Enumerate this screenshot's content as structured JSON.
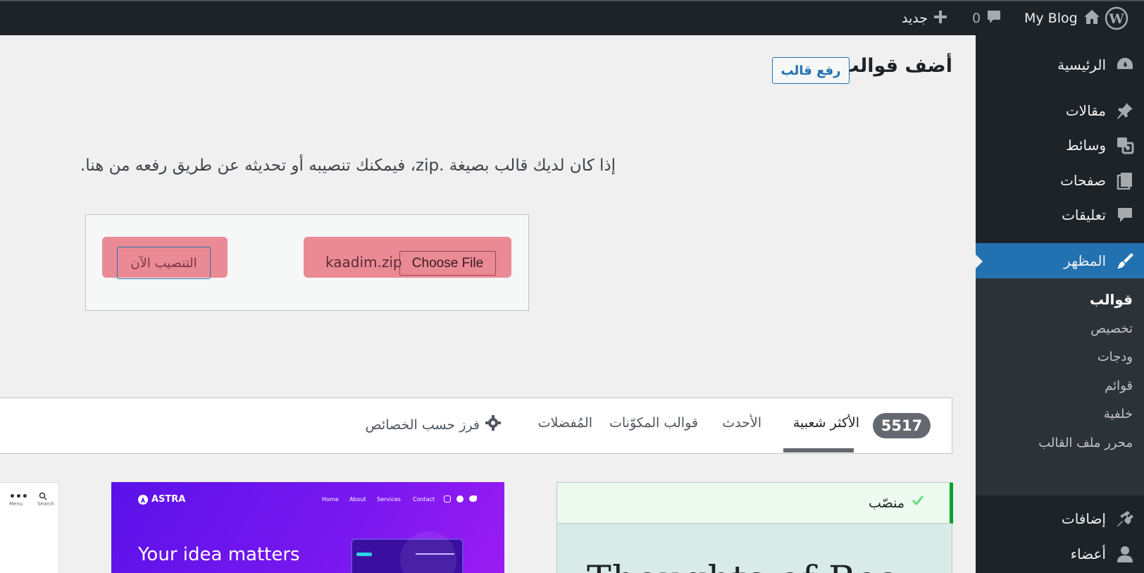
{
  "adminbar": {
    "site_name": "My Blog",
    "comments_count": "0",
    "new_label": "جديد"
  },
  "sidebar": {
    "items": [
      {
        "label": "الرئيسية",
        "icon": "dashboard-icon"
      },
      {
        "label": "مقالات",
        "icon": "pin-icon"
      },
      {
        "label": "وسائط",
        "icon": "media-icon"
      },
      {
        "label": "صفحات",
        "icon": "pages-icon"
      },
      {
        "label": "تعليقات",
        "icon": "comment-icon"
      },
      {
        "label": "المظهر",
        "icon": "appearance-icon"
      },
      {
        "label": "إضافات",
        "icon": "plugin-icon"
      },
      {
        "label": "أعضاء",
        "icon": "user-icon"
      }
    ],
    "submenu": [
      "قوالب",
      "تخصيص",
      "ودجات",
      "قوائم",
      "خلفية",
      "محرر ملف القالب"
    ]
  },
  "main": {
    "page_title": "أضف قوالب",
    "upload_button": "رفع قالب",
    "intro_text": "إذا كان لديك قالب بصيغة .zip، فيمكنك تنصيبه أو تحديثه عن طريق رفعه من هنا.",
    "install_now": "التنصيب الآن",
    "file_name": "kaadim.zip",
    "choose_file": "Choose File"
  },
  "filter": {
    "count": "5517",
    "tabs": [
      "الأكثر شعبية",
      "الأحدث",
      "قوالب المكوّنات",
      "المُفضلات"
    ],
    "feature_filter": "فرز حسب الخصائص"
  },
  "cards": {
    "installed_label": "منصّب",
    "astra_logo": "ASTRA",
    "astra_nav": [
      "Home",
      "About",
      "Services",
      "Contact"
    ],
    "astra_headline": "Your idea matters",
    "left_menu_label": "Menu",
    "left_search_label": "Search",
    "preview_text": "Thoughts of Bea"
  },
  "colors": {
    "adminbar": "#1d2327",
    "accent": "#2271b1",
    "installed_green": "#00a32a",
    "highlight": "#ea8a95",
    "astra_purple": "#5a12e8"
  }
}
